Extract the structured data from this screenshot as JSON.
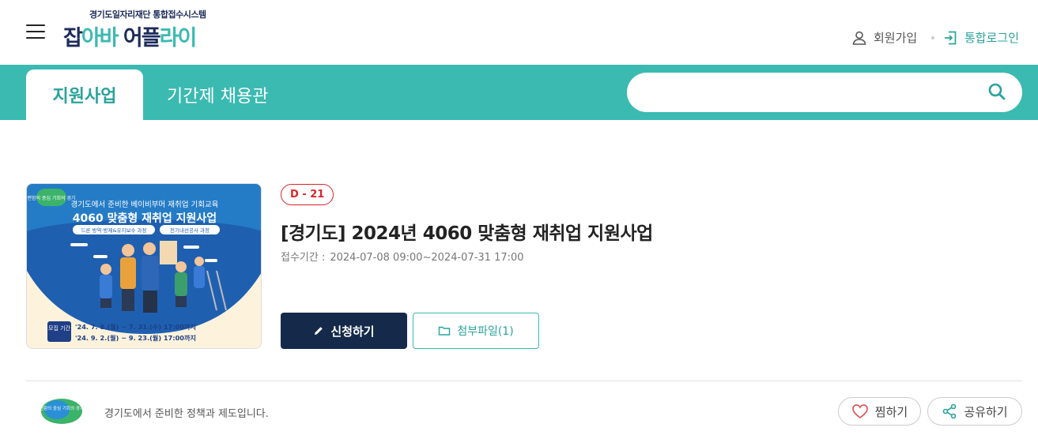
{
  "header": {
    "logo_sub": "경기도일자리재단 통합접수시스템",
    "logo_main": [
      "잡",
      "아바",
      " 어플",
      "라이"
    ],
    "join_label": "회원가입",
    "login_label": "통합로그인"
  },
  "nav": {
    "active_tab": "지원사업",
    "tab2": "기간제 채용관",
    "search_placeholder": ""
  },
  "poster": {
    "badge": "편함의 중심 기회의 경기",
    "lead": "경기도에서 준비한 베이비부머 재취업 기회교육",
    "headline": "4060 맞춤형 재취업 지원사업",
    "course1": "드론 방역·방제&유지보수 과정",
    "course2": "전기내선공사 과정",
    "period_label": "모집 기간",
    "period_line1": "'24. 7. 8.(월) ~ 7. 31.(수) 17:00까지",
    "period_line2": "'24. 9. 2.(월) ~ 9. 23.(월) 17:00까지"
  },
  "card": {
    "dday": "D - 21",
    "title": "[경기도] 2024년 4060 맞춤형 재취업 지원사업",
    "period_label": "접수기간 :",
    "period_value": "2024-07-08 09:00~2024-07-31 17:00",
    "apply_label": "신청하기",
    "file_label": "첨부파일(1)"
  },
  "footer": {
    "org_logo_text": "편함의 중심 기회의 경기",
    "org_text": "경기도에서 준비한 정책과 제도입니다.",
    "like_label": "찜하기",
    "share_label": "공유하기"
  },
  "colors": {
    "teal": "#3bbab1",
    "navy": "#152a4a",
    "dday_red": "#d9252a"
  },
  "icons": [
    "menu-icon",
    "user-icon",
    "login-icon",
    "search-icon",
    "pencil-icon",
    "folder-icon",
    "heart-icon",
    "share-icon"
  ]
}
